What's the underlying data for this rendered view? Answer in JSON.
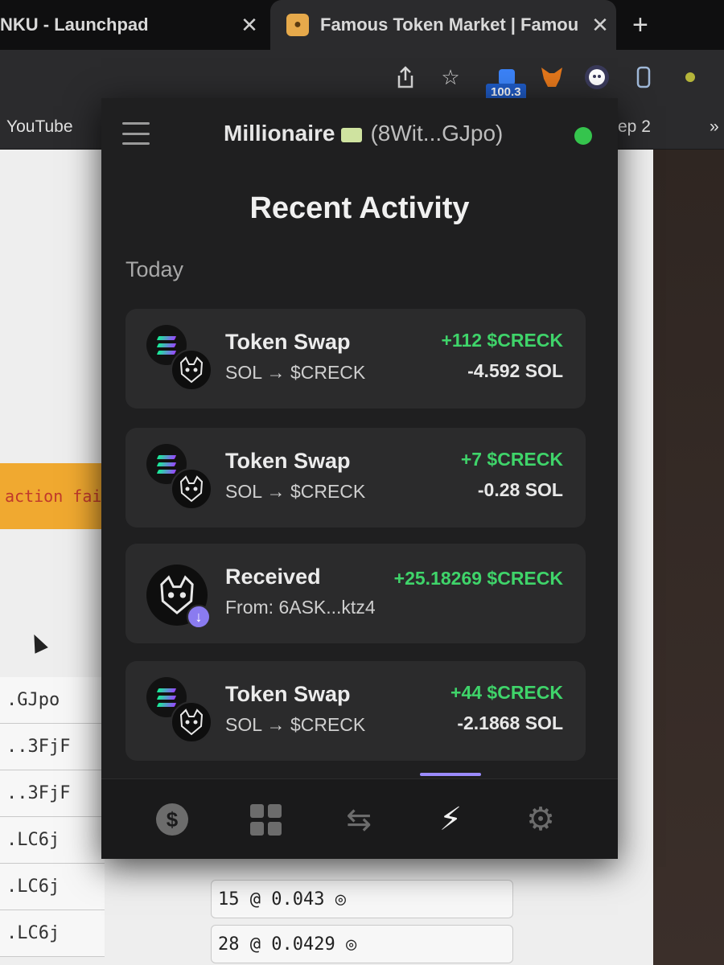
{
  "browser": {
    "tabs": [
      {
        "label": "NKU - Launchpad",
        "close": "✕"
      },
      {
        "label": "Famous Token Market | Famou",
        "close": "✕"
      }
    ],
    "new_tab": "+",
    "extension_badge": "100.3",
    "bookmarks": [
      {
        "label": "YouTube"
      },
      {
        "label": "ep 2"
      },
      {
        "label": "»"
      }
    ]
  },
  "page": {
    "warning_text": "action failu",
    "address_list": [
      ".GJpo",
      "..3FjF",
      "..3FjF",
      ".LC6j",
      ".LC6j",
      ".LC6j"
    ],
    "orders": [
      "15 @ 0.043 ◎",
      "28 @ 0.0429 ◎"
    ]
  },
  "wallet": {
    "account_name": "Millionaire",
    "account_address": "(8Wit...GJpo)",
    "title": "Recent Activity",
    "section": "Today",
    "activities": [
      {
        "type": "swap",
        "title": "Token Swap",
        "subtitle": "SOL → $CRECK",
        "amount_in": "+112 $CRECK",
        "amount_out": "-4.592 SOL"
      },
      {
        "type": "swap",
        "title": "Token Swap",
        "subtitle": "SOL → $CRECK",
        "amount_in": "+7 $CRECK",
        "amount_out": "-0.28 SOL"
      },
      {
        "type": "received",
        "title": "Received",
        "subtitle": "From: 6ASK...ktz4",
        "amount_in": "+25.18269 $CRECK",
        "amount_out": ""
      },
      {
        "type": "swap",
        "title": "Token Swap",
        "subtitle": "SOL → $CRECK",
        "amount_in": "+44 $CRECK",
        "amount_out": "-2.1868 SOL"
      }
    ],
    "nav": {
      "items": [
        "dollar-icon",
        "grid-icon",
        "swap-icon",
        "lightning-icon",
        "gear-icon"
      ],
      "active": "lightning-icon",
      "accent_color": "#9c8cff"
    },
    "colors": {
      "positive": "#3fd46a",
      "status_online": "#35c44d"
    }
  }
}
